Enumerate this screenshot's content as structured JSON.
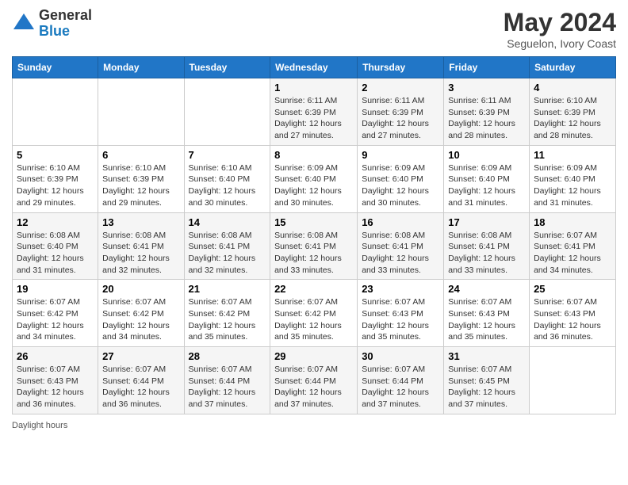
{
  "logo": {
    "general": "General",
    "blue": "Blue"
  },
  "title": "May 2024",
  "subtitle": "Seguelon, Ivory Coast",
  "days_of_week": [
    "Sunday",
    "Monday",
    "Tuesday",
    "Wednesday",
    "Thursday",
    "Friday",
    "Saturday"
  ],
  "footer": "Daylight hours",
  "weeks": [
    [
      {
        "day": "",
        "info": ""
      },
      {
        "day": "",
        "info": ""
      },
      {
        "day": "",
        "info": ""
      },
      {
        "day": "1",
        "info": "Sunrise: 6:11 AM\nSunset: 6:39 PM\nDaylight: 12 hours\nand 27 minutes."
      },
      {
        "day": "2",
        "info": "Sunrise: 6:11 AM\nSunset: 6:39 PM\nDaylight: 12 hours\nand 27 minutes."
      },
      {
        "day": "3",
        "info": "Sunrise: 6:11 AM\nSunset: 6:39 PM\nDaylight: 12 hours\nand 28 minutes."
      },
      {
        "day": "4",
        "info": "Sunrise: 6:10 AM\nSunset: 6:39 PM\nDaylight: 12 hours\nand 28 minutes."
      }
    ],
    [
      {
        "day": "5",
        "info": "Sunrise: 6:10 AM\nSunset: 6:39 PM\nDaylight: 12 hours\nand 29 minutes."
      },
      {
        "day": "6",
        "info": "Sunrise: 6:10 AM\nSunset: 6:39 PM\nDaylight: 12 hours\nand 29 minutes."
      },
      {
        "day": "7",
        "info": "Sunrise: 6:10 AM\nSunset: 6:40 PM\nDaylight: 12 hours\nand 30 minutes."
      },
      {
        "day": "8",
        "info": "Sunrise: 6:09 AM\nSunset: 6:40 PM\nDaylight: 12 hours\nand 30 minutes."
      },
      {
        "day": "9",
        "info": "Sunrise: 6:09 AM\nSunset: 6:40 PM\nDaylight: 12 hours\nand 30 minutes."
      },
      {
        "day": "10",
        "info": "Sunrise: 6:09 AM\nSunset: 6:40 PM\nDaylight: 12 hours\nand 31 minutes."
      },
      {
        "day": "11",
        "info": "Sunrise: 6:09 AM\nSunset: 6:40 PM\nDaylight: 12 hours\nand 31 minutes."
      }
    ],
    [
      {
        "day": "12",
        "info": "Sunrise: 6:08 AM\nSunset: 6:40 PM\nDaylight: 12 hours\nand 31 minutes."
      },
      {
        "day": "13",
        "info": "Sunrise: 6:08 AM\nSunset: 6:41 PM\nDaylight: 12 hours\nand 32 minutes."
      },
      {
        "day": "14",
        "info": "Sunrise: 6:08 AM\nSunset: 6:41 PM\nDaylight: 12 hours\nand 32 minutes."
      },
      {
        "day": "15",
        "info": "Sunrise: 6:08 AM\nSunset: 6:41 PM\nDaylight: 12 hours\nand 33 minutes."
      },
      {
        "day": "16",
        "info": "Sunrise: 6:08 AM\nSunset: 6:41 PM\nDaylight: 12 hours\nand 33 minutes."
      },
      {
        "day": "17",
        "info": "Sunrise: 6:08 AM\nSunset: 6:41 PM\nDaylight: 12 hours\nand 33 minutes."
      },
      {
        "day": "18",
        "info": "Sunrise: 6:07 AM\nSunset: 6:41 PM\nDaylight: 12 hours\nand 34 minutes."
      }
    ],
    [
      {
        "day": "19",
        "info": "Sunrise: 6:07 AM\nSunset: 6:42 PM\nDaylight: 12 hours\nand 34 minutes."
      },
      {
        "day": "20",
        "info": "Sunrise: 6:07 AM\nSunset: 6:42 PM\nDaylight: 12 hours\nand 34 minutes."
      },
      {
        "day": "21",
        "info": "Sunrise: 6:07 AM\nSunset: 6:42 PM\nDaylight: 12 hours\nand 35 minutes."
      },
      {
        "day": "22",
        "info": "Sunrise: 6:07 AM\nSunset: 6:42 PM\nDaylight: 12 hours\nand 35 minutes."
      },
      {
        "day": "23",
        "info": "Sunrise: 6:07 AM\nSunset: 6:43 PM\nDaylight: 12 hours\nand 35 minutes."
      },
      {
        "day": "24",
        "info": "Sunrise: 6:07 AM\nSunset: 6:43 PM\nDaylight: 12 hours\nand 35 minutes."
      },
      {
        "day": "25",
        "info": "Sunrise: 6:07 AM\nSunset: 6:43 PM\nDaylight: 12 hours\nand 36 minutes."
      }
    ],
    [
      {
        "day": "26",
        "info": "Sunrise: 6:07 AM\nSunset: 6:43 PM\nDaylight: 12 hours\nand 36 minutes."
      },
      {
        "day": "27",
        "info": "Sunrise: 6:07 AM\nSunset: 6:44 PM\nDaylight: 12 hours\nand 36 minutes."
      },
      {
        "day": "28",
        "info": "Sunrise: 6:07 AM\nSunset: 6:44 PM\nDaylight: 12 hours\nand 37 minutes."
      },
      {
        "day": "29",
        "info": "Sunrise: 6:07 AM\nSunset: 6:44 PM\nDaylight: 12 hours\nand 37 minutes."
      },
      {
        "day": "30",
        "info": "Sunrise: 6:07 AM\nSunset: 6:44 PM\nDaylight: 12 hours\nand 37 minutes."
      },
      {
        "day": "31",
        "info": "Sunrise: 6:07 AM\nSunset: 6:45 PM\nDaylight: 12 hours\nand 37 minutes."
      },
      {
        "day": "",
        "info": ""
      }
    ]
  ]
}
